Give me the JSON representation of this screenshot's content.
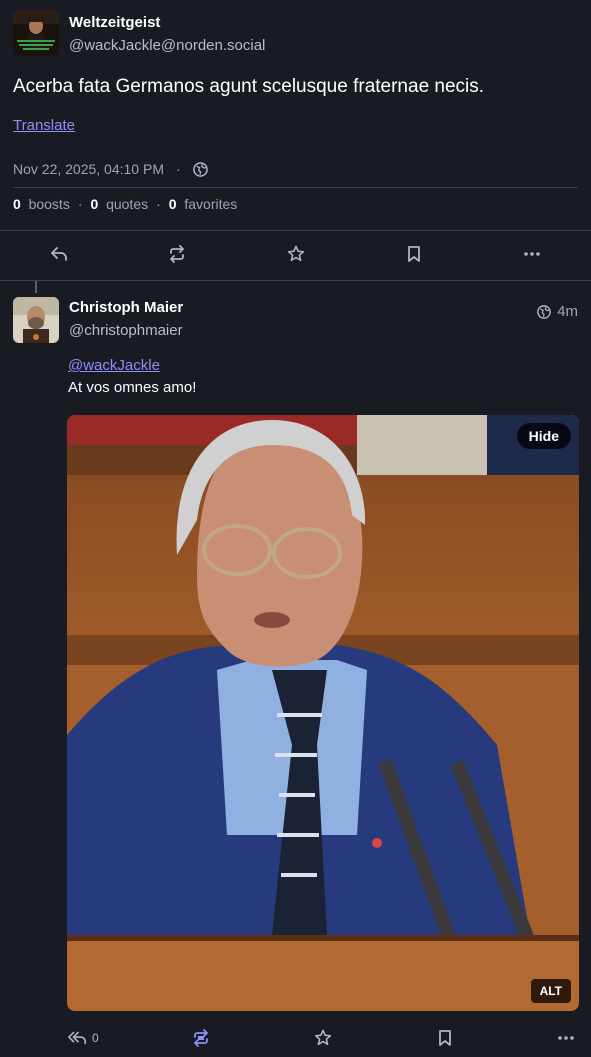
{
  "original_post": {
    "display_name": "Weltzeitgeist",
    "handle": "@wackJackle@norden.social",
    "text": "Acerba fata Germanos agunt scelusque fraternae necis.",
    "translate_label": "Translate",
    "timestamp": "Nov 22, 2025, 04:10 PM",
    "separator": "·",
    "visibility_icon": "globe-icon",
    "stats": {
      "boosts_count": "0",
      "boosts_label": "boosts",
      "quotes_count": "0",
      "quotes_label": "quotes",
      "favorites_count": "0",
      "favorites_label": "favorites",
      "separator": "·"
    },
    "actions": [
      "reply-icon",
      "boost-icon",
      "star-icon",
      "bookmark-icon",
      "more-icon"
    ]
  },
  "reply": {
    "display_name": "Christoph Maier",
    "handle": "@christophmaier",
    "time": "4m",
    "visibility_icon": "globe-icon",
    "mention": "@wackJackle",
    "text": "At vos omnes amo!",
    "media": {
      "hide_label": "Hide",
      "alt_label": "ALT"
    },
    "actions": {
      "reply_count": "0"
    }
  },
  "colors": {
    "background": "#191b22",
    "link": "#8c8dff",
    "boost_active": "#8c8dff",
    "muted": "#9ea3b8",
    "divider": "#393f4f"
  }
}
